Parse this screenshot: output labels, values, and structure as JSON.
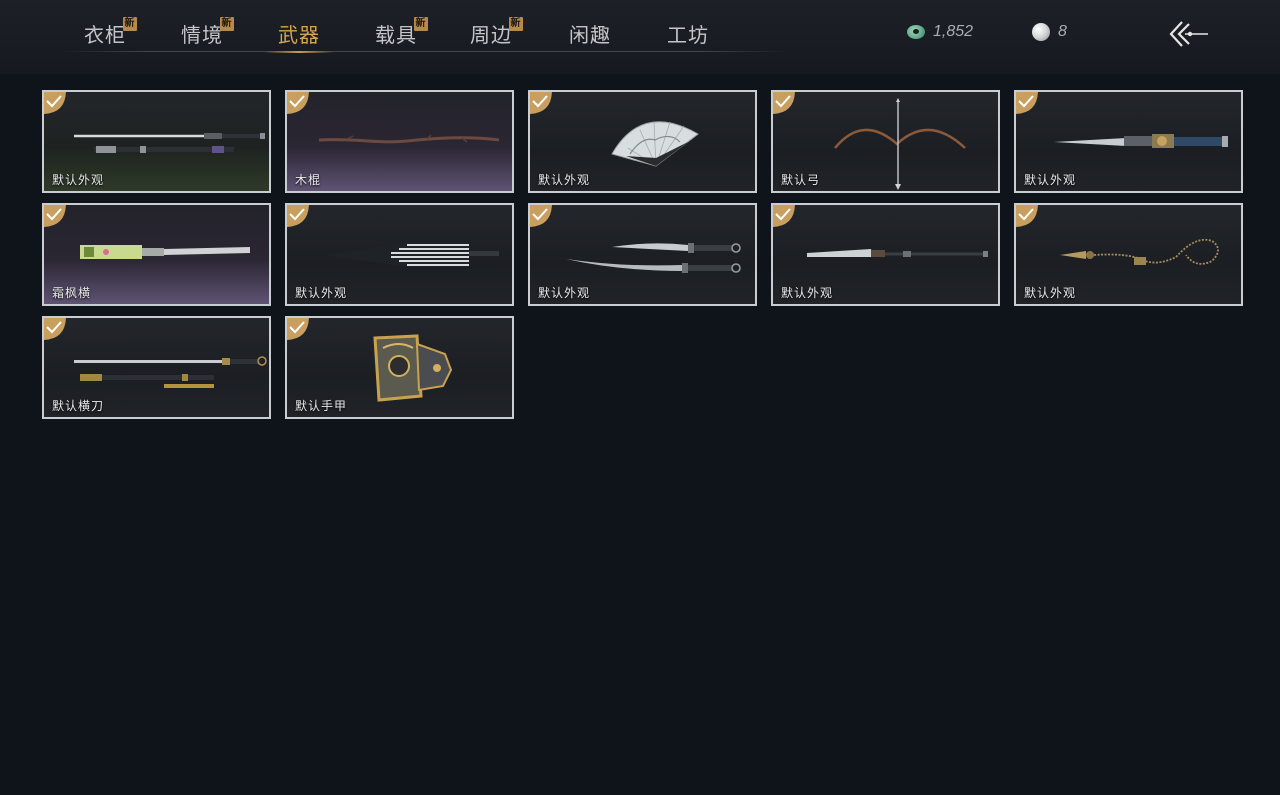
{
  "tabs": [
    {
      "label": "衣柜",
      "new": true,
      "new_label": "新",
      "active": false
    },
    {
      "label": "情境",
      "new": true,
      "new_label": "新",
      "active": false
    },
    {
      "label": "武器",
      "new": false,
      "active": true
    },
    {
      "label": "载具",
      "new": true,
      "new_label": "新",
      "active": false
    },
    {
      "label": "周边",
      "new": true,
      "new_label": "新",
      "active": false
    },
    {
      "label": "闲趣",
      "new": false,
      "active": false
    },
    {
      "label": "工坊",
      "new": false,
      "active": false
    }
  ],
  "currency": {
    "jade_value": "1,852",
    "pearl_value": "8"
  },
  "colors": {
    "accent": "#d7a54f",
    "background": "#0f131a",
    "card_border": "#c9ccd0",
    "check_badge": "#c89f5e"
  },
  "items": [
    {
      "label": "默认外观",
      "icon": "sword-and-scabbard-icon",
      "equipped": true
    },
    {
      "label": "木棍",
      "icon": "wooden-staff-icon",
      "equipped": true
    },
    {
      "label": "默认外观",
      "icon": "folding-fan-icon",
      "equipped": true
    },
    {
      "label": "默认弓",
      "icon": "bow-icon",
      "equipped": true
    },
    {
      "label": "默认外观",
      "icon": "ornate-blade-icon",
      "equipped": true
    },
    {
      "label": "霜枫横",
      "icon": "jade-blade-icon",
      "equipped": true
    },
    {
      "label": "默认外观",
      "icon": "umbrella-icon",
      "equipped": true
    },
    {
      "label": "默认外观",
      "icon": "dual-blades-icon",
      "equipped": true
    },
    {
      "label": "默认外观",
      "icon": "spear-icon",
      "equipped": true
    },
    {
      "label": "默认外观",
      "icon": "rope-dart-icon",
      "equipped": true
    },
    {
      "label": "默认横刀",
      "icon": "hengdao-icon",
      "equipped": true
    },
    {
      "label": "默认手甲",
      "icon": "gauntlet-icon",
      "equipped": true
    }
  ]
}
